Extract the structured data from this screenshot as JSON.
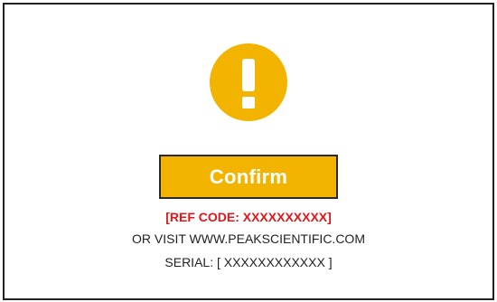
{
  "dialog": {
    "icon": "exclamation-circle-icon",
    "accent_color": "#f2b400",
    "confirm_label": "Confirm",
    "ref_code": "[REF CODE: XXXXXXXXXX]",
    "ref_code_color": "#e3161b",
    "visit_text": "OR VISIT WWW.PEAKSCIENTIFIC.COM",
    "serial_text": "SERIAL: [ XXXXXXXXXXXX ]"
  }
}
